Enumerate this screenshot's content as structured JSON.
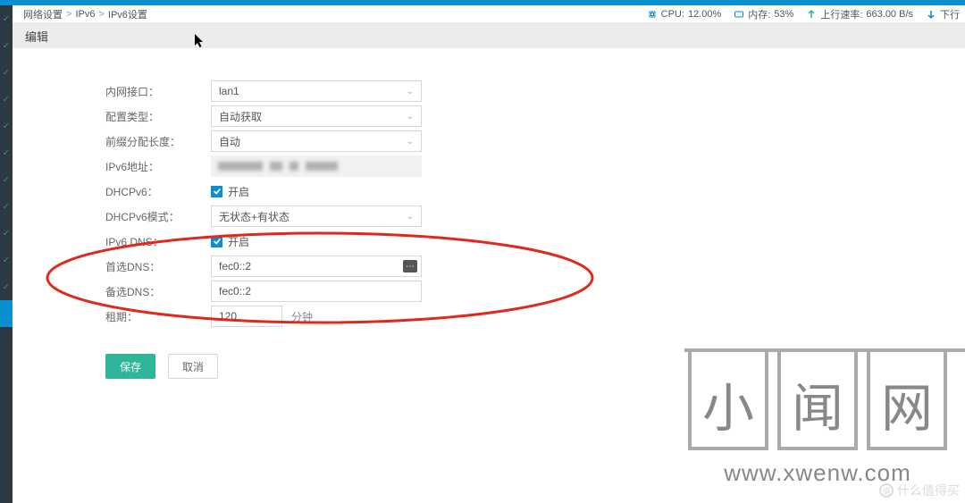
{
  "breadcrumb": {
    "level1": "网络设置",
    "level2": "IPv6",
    "level3": "IPv6设置",
    "sep": ">"
  },
  "stats": {
    "cpu_label": "CPU:",
    "cpu_value": "12.00%",
    "mem_label": "内存:",
    "mem_value": "53%",
    "up_label": "上行速率:",
    "up_value": "663.00 B/s",
    "down_label": "下行"
  },
  "section_title": "编辑",
  "form": {
    "lan_iface": {
      "label": "内网接口",
      "value": "lan1"
    },
    "cfg_type": {
      "label": "配置类型",
      "value": "自动获取"
    },
    "prefix_len": {
      "label": "前缀分配长度",
      "value": "自动"
    },
    "ipv6_addr": {
      "label": "IPv6地址",
      "value_obscured": true
    },
    "dhcpv6": {
      "label": "DHCPv6",
      "enabled_text": "开启",
      "checked": true
    },
    "dhcpv6_mode": {
      "label": "DHCPv6模式",
      "value": "无状态+有状态"
    },
    "ipv6_dns": {
      "label": "IPv6 DNS",
      "enabled_text": "开启",
      "checked": true
    },
    "dns_primary": {
      "label": "首选DNS",
      "value": "fec0::2"
    },
    "dns_backup": {
      "label": "备选DNS",
      "value": "fec0::2"
    },
    "lease": {
      "label": "租期",
      "value": "120",
      "unit": "分钟"
    }
  },
  "buttons": {
    "save": "保存",
    "cancel": "取消"
  },
  "watermark": {
    "ch1": "小",
    "ch2": "闻",
    "ch3": "网",
    "url": "www.xwenw.com",
    "corner": "什么值得买"
  },
  "colors": {
    "accent": "#0a8fd1",
    "primary_btn": "#2fb59a",
    "annotation": "#e1281b"
  }
}
